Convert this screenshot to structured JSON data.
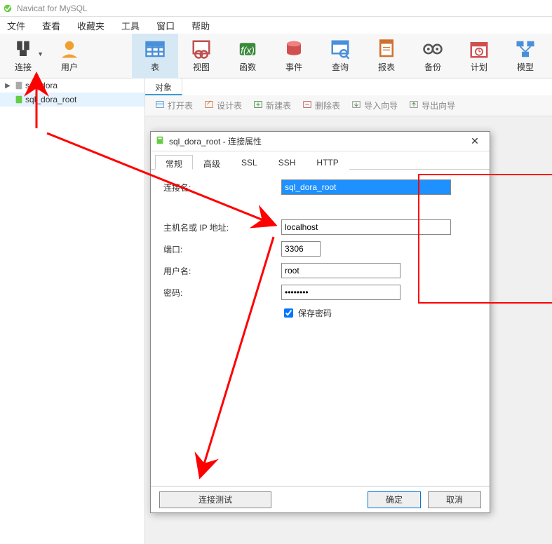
{
  "app": {
    "title": "Navicat for MySQL"
  },
  "menubar": [
    "文件",
    "查看",
    "收藏夹",
    "工具",
    "窗口",
    "帮助"
  ],
  "toolbar": [
    {
      "key": "connect",
      "label": "连接",
      "color": "#444",
      "dropdown": true
    },
    {
      "key": "user",
      "label": "用户",
      "color": "#f0a030"
    },
    {
      "key": "table",
      "label": "表",
      "color": "#4a90d9",
      "active": true
    },
    {
      "key": "view",
      "label": "视图",
      "color": "#c05050"
    },
    {
      "key": "func",
      "label": "函数",
      "color": "#3a8a3a"
    },
    {
      "key": "event",
      "label": "事件",
      "color": "#d05050"
    },
    {
      "key": "query",
      "label": "查询",
      "color": "#4a90d9"
    },
    {
      "key": "report",
      "label": "报表",
      "color": "#d07030"
    },
    {
      "key": "backup",
      "label": "备份",
      "color": "#555"
    },
    {
      "key": "schedule",
      "label": "计划",
      "color": "#d05050"
    },
    {
      "key": "model",
      "label": "模型",
      "color": "#4a90d9"
    }
  ],
  "tree": [
    {
      "name": "sql_dora",
      "selected": false
    },
    {
      "name": "sql_dora_root",
      "selected": true
    }
  ],
  "obj_tab": "对象",
  "obj_toolbar": [
    "打开表",
    "设计表",
    "新建表",
    "删除表",
    "导入向导",
    "导出向导"
  ],
  "dialog": {
    "title_conn": "sql_dora_root",
    "title_suffix": " - 连接属性",
    "tabs": [
      "常规",
      "高级",
      "SSL",
      "SSH",
      "HTTP"
    ],
    "labels": {
      "conn_name": "连接名:",
      "host": "主机名或 IP 地址:",
      "port": "端口:",
      "user": "用户名:",
      "pass": "密码:",
      "save_pass": "保存密码"
    },
    "values": {
      "conn_name": "sql_dora_root",
      "host": "localhost",
      "port": "3306",
      "user": "root",
      "pass": "••••••••"
    },
    "buttons": {
      "test": "连接测试",
      "ok": "确定",
      "cancel": "取消"
    }
  }
}
